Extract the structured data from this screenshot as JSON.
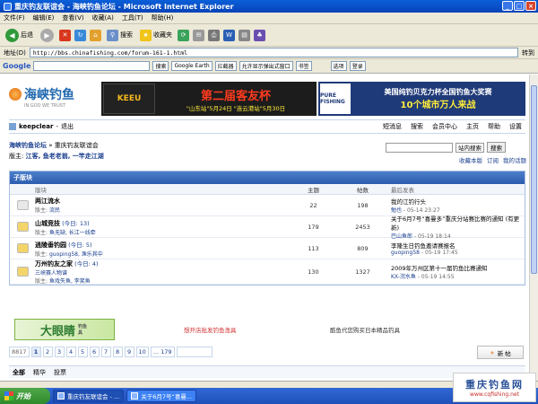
{
  "window": {
    "title": "重庆钓友联谊会 - 海峡钓鱼论坛 - Microsoft Internet Explorer",
    "min": "_",
    "max": "□",
    "close": "×"
  },
  "menu": [
    "文件(F)",
    "编辑(E)",
    "查看(V)",
    "收藏(A)",
    "工具(T)",
    "帮助(H)"
  ],
  "toolbar": {
    "back": "后退",
    "search": "搜索",
    "favorites": "收藏夹"
  },
  "address": {
    "label": "地址(D)",
    "url": "http://bbs.chinafishing.com/forum-161-1.html",
    "go": "转到"
  },
  "google_bar": {
    "logo": "Google",
    "search_btn": "搜索",
    "earth": "Google Earth",
    "block": "拦截器",
    "popup": "允许显示弹出式窗口",
    "bookmarks": "书签",
    "options": "选项",
    "login": "登录"
  },
  "logo": {
    "cn": "海峡钓鱼",
    "en": "IN GOD WE TRUST"
  },
  "ad_keeu": {
    "brand": "KEEU",
    "title": "第二届客友杯",
    "sub": "\"山东站\"5月24日 \"连云港站\"5月30日"
  },
  "ad_pure": {
    "brand": "PURE FISHING",
    "l1": "美国纯钓贝克力杯全国钓鱼大奖赛",
    "l2": "10个城市万人来战"
  },
  "user": {
    "name": "keepclear",
    "logout": "退出",
    "links": [
      "短消息",
      "搜索",
      "会员中心",
      "主页",
      "帮助",
      "设置"
    ]
  },
  "breadcrumb": {
    "home": "海峡钓鱼论坛",
    "sep": "»",
    "current": "重庆钓友联谊会"
  },
  "moderators": {
    "label": "版主:",
    "names": "江客, 鱼老老翁, 一竿走江湖"
  },
  "search": {
    "scope": "站内搜索",
    "btn": "搜索",
    "links": [
      "收藏本版",
      "订阅",
      "我的话题"
    ]
  },
  "subforum": {
    "header": "子版块",
    "cols": [
      "版块",
      "主题",
      "帖数",
      "最后发表"
    ],
    "rows": [
      {
        "name": "两江流水",
        "today": "",
        "mod_label": "版主:",
        "mods": "流民",
        "topics": "22",
        "posts": "198",
        "last_title": "我的江钓行头",
        "last_by": "勉也",
        "last_time": "- 05-14 23:27",
        "color": "#e8e8e8"
      },
      {
        "name": "山城竞技",
        "today": "(今日: 13)",
        "mod_label": "版主:",
        "mods": "鱼无缺, 长江一线牵",
        "topics": "179",
        "posts": "2453",
        "last_title": "关于6月7号“喜曼多”重庆分站赛比赛的通知 (有更新)",
        "last_by": "巴山鱼郎",
        "last_time": "- 05-19 18:14",
        "color": "#f3d56a"
      },
      {
        "name": "逍陵垂钓园",
        "today": "(今日: 5)",
        "mod_label": "版主:",
        "mods": "guoping58, 渔乐其中",
        "topics": "113",
        "posts": "809",
        "last_title": "李隆生日钓鱼邀请赛报名",
        "last_by": "guoping58",
        "last_time": "- 05-19 17:45",
        "color": "#f3d56a"
      },
      {
        "name": "万州钓友之家",
        "today": "(今日: 4)",
        "sub": "三峡赛人物谱",
        "mod_label": "版主:",
        "mods": "鱼戏失鱼, 李笑鱼",
        "topics": "130",
        "posts": "1327",
        "last_title": "2009年万州区第十一届钓鱼比赛通知",
        "last_by": "KX-浣水鱼",
        "last_time": "- 05-19 14:55",
        "color": "#f3d56a"
      }
    ]
  },
  "ads_mid": {
    "eye": "大眼睛",
    "eye_sub": "钓鱼具",
    "red": "想开店批发钓鱼渔具",
    "mid": "酷鱼代您购买日本精品钓具"
  },
  "pager": {
    "total": "8817",
    "pages": [
      "1",
      "2",
      "3",
      "4",
      "5",
      "6",
      "7",
      "8",
      "9",
      "10",
      "... 179"
    ],
    "new_post": "新 帖"
  },
  "tabs": [
    "全部",
    "精华",
    "投票"
  ],
  "taskbar": {
    "start": "开始",
    "tasks": [
      "重庆钓友联谊会 - ...",
      "关于6月7号“喜曼..."
    ]
  },
  "watermark": {
    "cn": "重庆钓鱼网",
    "url": "www.cqfishing.net"
  }
}
